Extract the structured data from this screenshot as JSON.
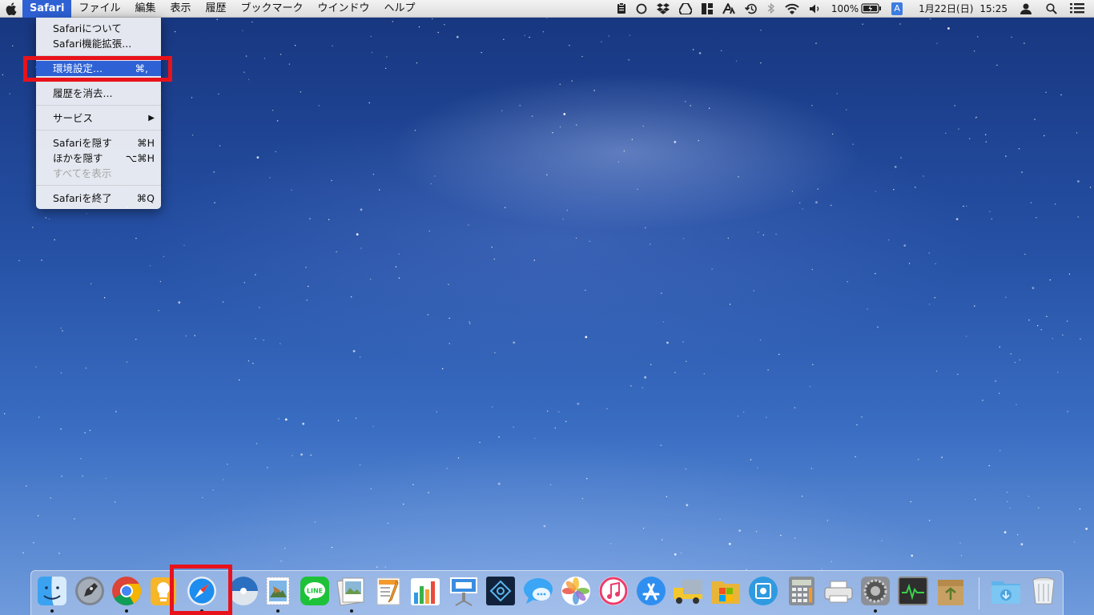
{
  "menubar": {
    "app_name": "Safari",
    "menus": [
      "ファイル",
      "編集",
      "表示",
      "履歴",
      "ブックマーク",
      "ウインドウ",
      "ヘルプ"
    ],
    "status": {
      "battery": "100%",
      "input_source": "A",
      "date": "1月22日(日)",
      "time": "15:25"
    }
  },
  "app_menu": {
    "about": "Safariについて",
    "extensions": "Safari機能拡張...",
    "preferences": "環境設定...",
    "preferences_shortcut": "⌘,",
    "clear_history": "履歴を消去...",
    "services": "サービス",
    "services_arrow": "▶",
    "hide": "Safariを隠す",
    "hide_shortcut": "⌘H",
    "hide_others": "ほかを隠す",
    "hide_others_shortcut": "⌥⌘H",
    "show_all": "すべてを表示",
    "quit": "Safariを終了",
    "quit_shortcut": "⌘Q"
  },
  "dock": {
    "apps": [
      "finder-icon",
      "launchpad-icon",
      "chrome-icon",
      "tips-icon",
      "safari-icon",
      "disk-utility-icon",
      "mail-stamp-icon",
      "line-icon",
      "preview-icon",
      "pages-icon",
      "numbers-icon",
      "keynote-icon",
      "photoshop-icon",
      "messages-icon",
      "photos-icon",
      "itunes-icon",
      "app-store-icon",
      "transmit-icon",
      "folder-apps-icon",
      "screenshot-icon",
      "calculator-icon",
      "printer-icon",
      "system-preferences-icon",
      "activity-monitor-icon",
      "archive-utility-icon",
      "downloads-folder-icon",
      "trash-icon"
    ],
    "line_label": "LINE"
  },
  "colors": {
    "menu_highlight": "#2e61d4",
    "annotation_red": "#e8121b"
  }
}
